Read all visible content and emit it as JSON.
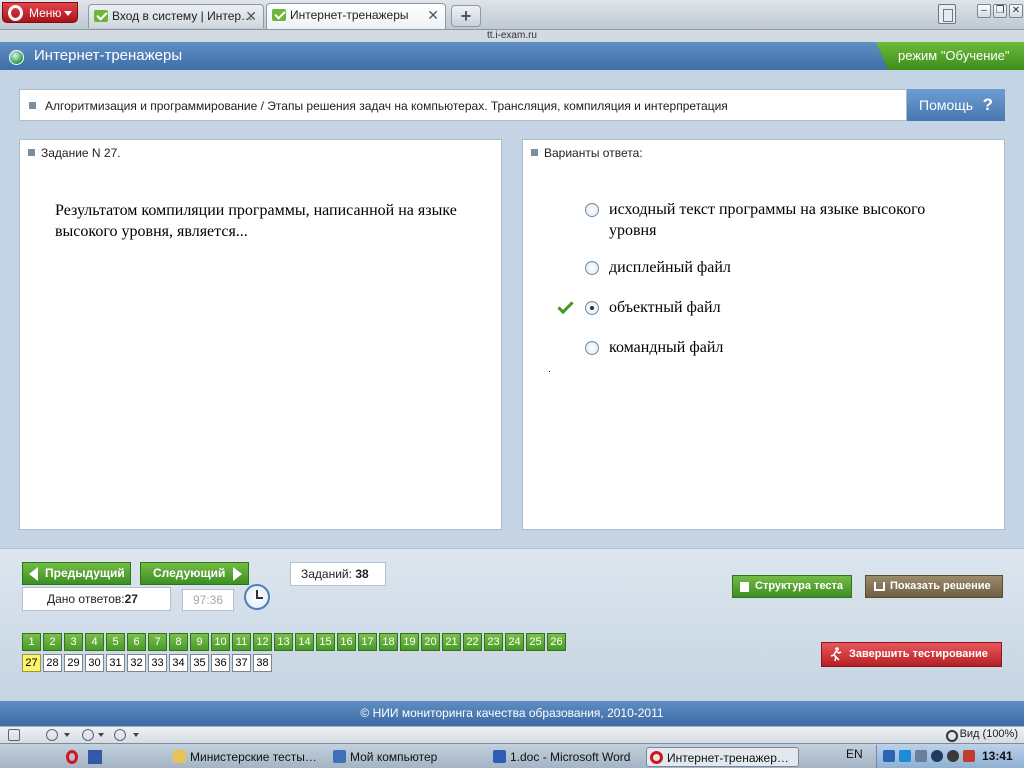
{
  "browser": {
    "menu_label": "Меню",
    "tabs": [
      {
        "title": "Вход в систему | Интер…"
      },
      {
        "title": "Интернет-тренажеры"
      }
    ],
    "address": "tt.i-exam.ru"
  },
  "app": {
    "title": "Интернет-тренажеры",
    "mode": "режим \"Обучение\"",
    "breadcrumb": "Алгоритмизация и программирование / Этапы решения задач на компьютерах. Трансляция, компиляция и интерпретация",
    "help_label": "Помощь",
    "help_icon": "?"
  },
  "question": {
    "header": "Задание N 27.",
    "text": "Результатом компиляции программы, написанной на языке высокого уровня, является..."
  },
  "answers": {
    "header": "Варианты ответа:",
    "options": [
      {
        "label": "исходный текст программы на языке высокого уровня",
        "selected": false
      },
      {
        "label": "дисплейный файл",
        "selected": false
      },
      {
        "label": "объектный файл",
        "selected": true
      },
      {
        "label": "командный файл",
        "selected": false
      }
    ]
  },
  "controls": {
    "prev_label": "Предыдущий",
    "next_label": "Следующий",
    "tasks_label": "Заданий:",
    "tasks_count": "38",
    "answered_label": "Дано ответов:",
    "answered_count": "27",
    "timer": "97:36",
    "structure_label": "Структура теста",
    "show_solution_label": "Показать решение",
    "finish_label": "Завершить тестирование",
    "numbers_answered": [
      "1",
      "2",
      "3",
      "4",
      "5",
      "6",
      "7",
      "8",
      "9",
      "10",
      "11",
      "12",
      "13",
      "14",
      "15",
      "16",
      "17",
      "18",
      "19",
      "20",
      "21",
      "22",
      "23",
      "24",
      "25",
      "26"
    ],
    "current_number": "27",
    "numbers_pending": [
      "28",
      "29",
      "30",
      "31",
      "32",
      "33",
      "34",
      "35",
      "36",
      "37",
      "38"
    ]
  },
  "footer": {
    "copyright": "© НИИ мониторинга качества образования, 2010-2011"
  },
  "statusbar": {
    "zoom": "Вид (100%)"
  },
  "taskbar": {
    "items": [
      {
        "label": "Министерские тесты…"
      },
      {
        "label": "Мой компьютер"
      },
      {
        "label": "1.doc - Microsoft Word"
      },
      {
        "label": "Интернет-тренажер…"
      }
    ],
    "lang": "EN",
    "time": "13:41"
  },
  "colors": {
    "accent_green": "#4a9b2a",
    "header_blue": "#3f6ea7",
    "finish_red": "#b52025",
    "current_yellow": "#fbf46a"
  }
}
